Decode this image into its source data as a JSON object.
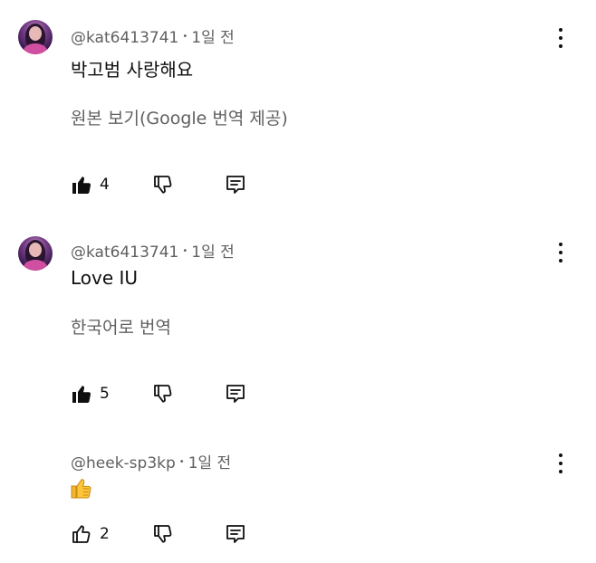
{
  "colors": {
    "text": "#0f0f0f",
    "secondary": "#606060",
    "avatar_accent": "#d14fa0"
  },
  "comments": [
    {
      "username": "@kat6413741",
      "separator": "•",
      "time": "1일 전",
      "text": "박고범 사랑해요",
      "translate_label": "원본 보기(Google 번역 제공)",
      "likes": "4",
      "like_icon": "thumb-up-filled-icon",
      "dislike_icon": "thumb-down-outline-icon",
      "reply_icon": "reply-comment-icon",
      "menu_icon": "more-vert-icon"
    },
    {
      "username": "@kat6413741",
      "separator": "•",
      "time": "1일 전",
      "text": "Love IU",
      "translate_label": "한국어로 번역",
      "likes": "5",
      "like_icon": "thumb-up-filled-icon",
      "dislike_icon": "thumb-down-outline-icon",
      "reply_icon": "reply-comment-icon",
      "menu_icon": "more-vert-icon"
    },
    {
      "username": "@heek-sp3kp",
      "separator": "•",
      "time": "1일 전",
      "emoji": "thumbs-up-emoji",
      "likes": "2",
      "like_icon": "thumb-up-outline-icon",
      "dislike_icon": "thumb-down-outline-icon",
      "reply_icon": "reply-comment-icon",
      "menu_icon": "more-vert-icon"
    }
  ]
}
